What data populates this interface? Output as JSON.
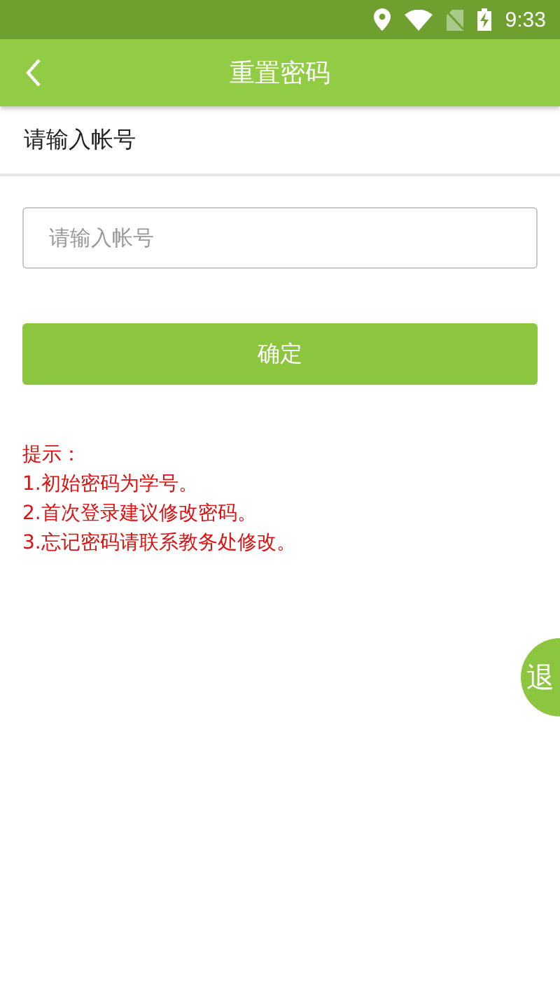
{
  "status_bar": {
    "time": "9:33"
  },
  "app_bar": {
    "title": "重置密码"
  },
  "section_label": "请输入帐号",
  "account_field": {
    "placeholder": "请输入帐号"
  },
  "confirm_button": "确定",
  "hints": [
    "提示：",
    "1.初始密码为学号。",
    "2.首次登录建议修改密码。",
    "3.忘记密码请联系教务处修改。"
  ],
  "floating_button": "退"
}
